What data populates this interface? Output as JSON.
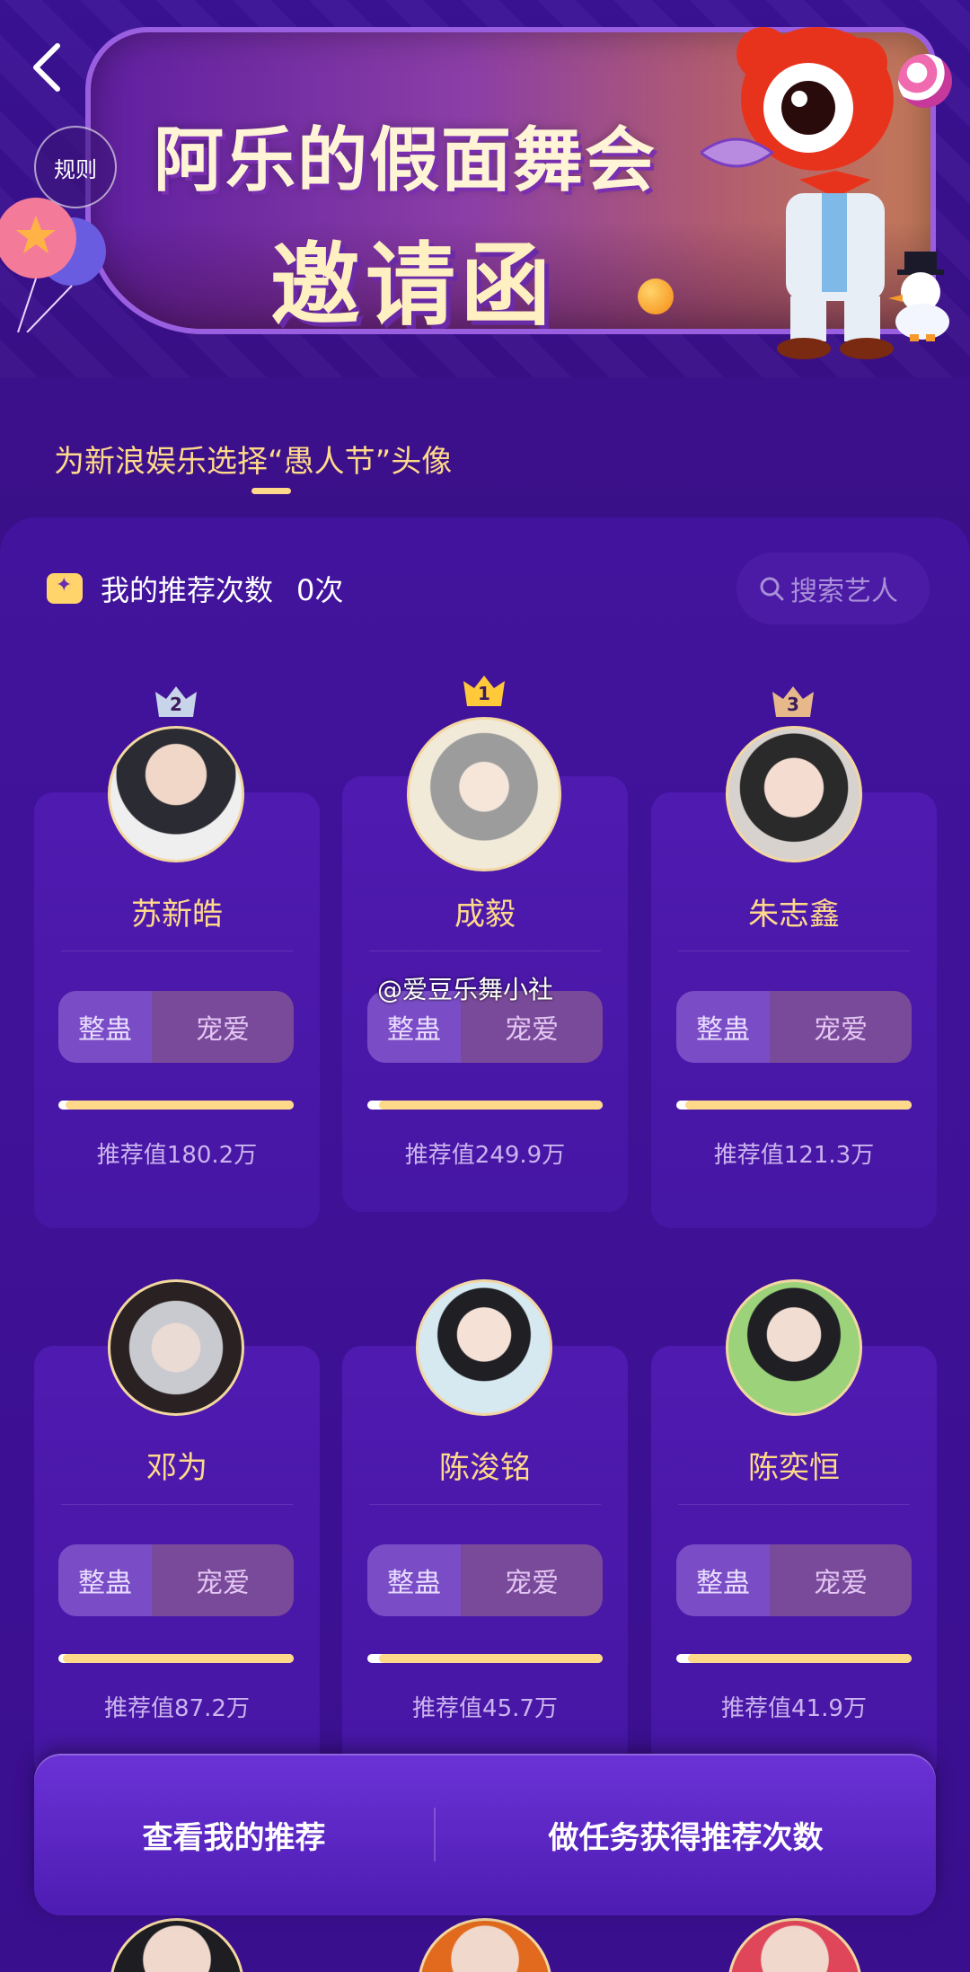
{
  "header": {
    "back_icon": "chevron-left-icon",
    "rules_label": "规则",
    "banner_title": "阿乐的假面舞会",
    "banner_subtitle": "邀请函"
  },
  "tab": {
    "label": "为新浪娱乐选择“愚人节”头像"
  },
  "summary": {
    "count_label": "我的推荐次数",
    "count_value": "0次",
    "search_placeholder": "搜索艺人"
  },
  "cards": [
    {
      "rank": "2",
      "name": "苏新皓",
      "btn_a": "整蛊",
      "btn_b": "宠爱",
      "rec": "推荐值180.2万",
      "progress": 0.97
    },
    {
      "rank": "1",
      "name": "成毅",
      "btn_a": "整蛊",
      "btn_b": "宠爱",
      "rec": "推荐值249.9万",
      "progress": 0.95
    },
    {
      "rank": "3",
      "name": "朱志鑫",
      "btn_a": "整蛊",
      "btn_b": "宠爱",
      "rec": "推荐值121.3万",
      "progress": 0.96
    },
    {
      "rank": "",
      "name": "邓为",
      "btn_a": "整蛊",
      "btn_b": "宠爱",
      "rec": "推荐值87.2万",
      "progress": 0.98
    },
    {
      "rank": "",
      "name": "陈浚铭",
      "btn_a": "整蛊",
      "btn_b": "宠爱",
      "rec": "推荐值45.7万",
      "progress": 0.95
    },
    {
      "rank": "",
      "name": "陈奕恒",
      "btn_a": "整蛊",
      "btn_b": "宠爱",
      "rec": "推荐值41.9万",
      "progress": 0.95
    }
  ],
  "watermark": "@爱豆乐舞小社",
  "bottom": {
    "left_label": "查看我的推荐",
    "right_label": "做任务获得推荐次数"
  },
  "colors": {
    "accent": "#ffd98a",
    "background": "#3a0f88",
    "card": "#4f1ab0",
    "button_a": "#7a4cc6",
    "button_b": "#7a4a9a"
  }
}
